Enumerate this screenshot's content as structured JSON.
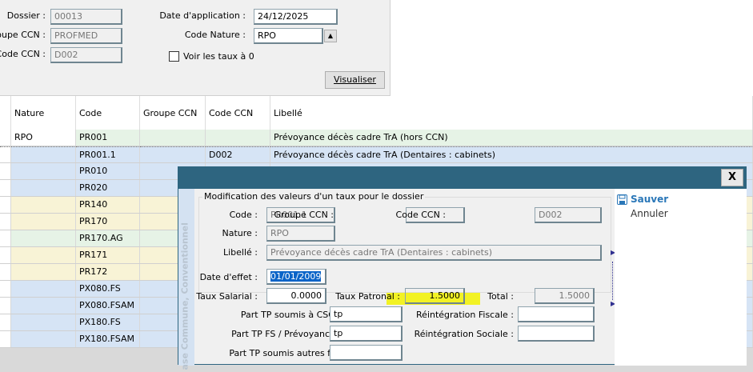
{
  "filters": {
    "dossier_label": "Dossier :",
    "dossier": "00013",
    "groupe_label": "oupe CCN :",
    "groupe": "PROFMED",
    "code_ccn_label": "Code CCN :",
    "code_ccn": "D002",
    "date_label": "Date d'application :",
    "date": "24/12/2025",
    "nature_label": "Code Nature :",
    "nature": "RPO",
    "voir_label": "Voir les taux à 0",
    "visualiser": "Visualiser"
  },
  "grid": {
    "headers": [
      "Nature",
      "Code",
      "Groupe CCN",
      "Code CCN",
      "Libellé"
    ],
    "rows": [
      {
        "nature": "RPO",
        "code": "PR001",
        "groupe": "",
        "ccn": "",
        "libelle": "Prévoyance décès cadre TrA (hors CCN)"
      },
      {
        "nature": "",
        "code": "PR001.1",
        "groupe": "",
        "ccn": "D002",
        "libelle": "Prévoyance décès cadre TrA (Dentaires : cabinets)"
      },
      {
        "code": "PR010"
      },
      {
        "code": "PR020"
      },
      {
        "code": "PR140"
      },
      {
        "code": "PR170"
      },
      {
        "code": "PR170.AG"
      },
      {
        "code": "PR171"
      },
      {
        "code": "PR172"
      },
      {
        "code": "PX080.FS"
      },
      {
        "code": "PX080.FSAM"
      },
      {
        "code": "PX180.FS"
      },
      {
        "code": "PX180.FSAM"
      }
    ]
  },
  "dialog": {
    "close": "X",
    "strip": "ase Commune, Conventionnel",
    "group_title": "Modification des valeurs d'un taux pour le dossier",
    "code_label": "Code :",
    "code": "PR001.1",
    "groupe_label": "Groupe CCN :",
    "groupe": "",
    "ccn_label": "Code CCN :",
    "ccn": "D002",
    "nature_label": "Nature :",
    "nature": "RPO",
    "libelle_label": "Libellé :",
    "libelle": "Prévoyance décès cadre TrA (Dentaires : cabinets)",
    "date_label": "Date d'effet :",
    "date": "01/01/2009",
    "sal_label": "Taux Salarial :",
    "sal": "0.0000",
    "pat_label": "Taux Patronal :",
    "pat": "1.5000",
    "total_label": "Total :",
    "total": "1.5000",
    "csg_label": "Part TP soumis à CSG :",
    "csg": "tp",
    "fs_label": "Part TP FS / Prévoyance :",
    "fs": "tp",
    "autres_label": "Part TP soumis autres fs :",
    "autres": "",
    "rfisc_label": "Réintégration Fiscale :",
    "rfisc": "",
    "rsoc_label": "Réintégration Sociale :",
    "rsoc": "",
    "save": "Sauver",
    "cancel": "Annuler"
  }
}
